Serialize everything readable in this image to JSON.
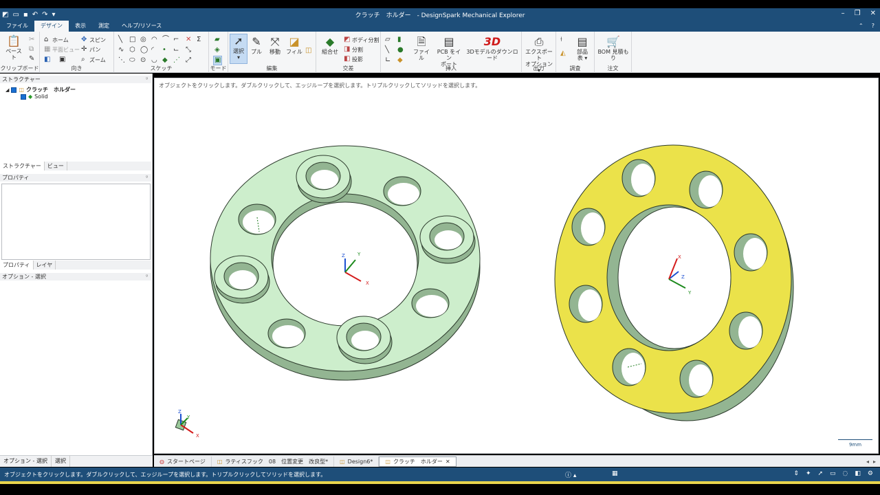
{
  "window": {
    "title": "クラッチ　ホルダー　- DesignSpark  Mechanical  Explorer"
  },
  "menu": {
    "tabs": [
      "ファイル",
      "デザイン",
      "表示",
      "測定",
      "ヘルプ/リソース"
    ],
    "active_index": 1
  },
  "ribbon": {
    "clipboard": {
      "paste": "ペースト",
      "label": "クリップボード"
    },
    "orient": {
      "home": "ホーム",
      "plan_view": "平面ビュー",
      "spin": "スピン",
      "pan": "パン",
      "zoom": "ズーム",
      "label": "向き"
    },
    "sketch": {
      "label": "スケッチ"
    },
    "mode": {
      "label": "モード"
    },
    "edit": {
      "select": "選択",
      "pull": "プル",
      "move": "移動",
      "fill": "フィル",
      "label": "編集"
    },
    "intersect": {
      "combine": "組合せ",
      "body_split": "ボディ分割",
      "split": "分割",
      "project": "投影",
      "label": "交差"
    },
    "insert": {
      "file": "ファイル",
      "pcb_line1": "PCB をイン",
      "pcb_line2": "ポート",
      "three_d_badge": "3D",
      "download": "3Dモデルのダウンロード",
      "label": "挿入"
    },
    "output": {
      "export_line1": "エクスポート",
      "export_line2": "オプション",
      "label": "出力"
    },
    "investigate": {
      "parts_line1": "部品",
      "parts_line2": "表",
      "label": "調査"
    },
    "order": {
      "bom_line1": "BOM 見積も",
      "bom_line2": "り",
      "label": "注文"
    }
  },
  "structure_panel": {
    "header": "ストラクチャー",
    "root": "クラッチ　ホルダー",
    "child": "Solid",
    "tabs": [
      "ストラクチャー",
      "ビュー"
    ]
  },
  "properties_panel": {
    "header": "プロパティ",
    "tabs": [
      "プロパティ",
      "レイヤ"
    ]
  },
  "options_panel": {
    "header": "オプション - 選択",
    "tabs": [
      "オプション - 選択",
      "選択"
    ]
  },
  "viewport": {
    "hint": "オブジェクトをクリックします。ダブルクリックして、エッジループを選択します。トリプルクリックしてソリッドを選択します。",
    "scale_label": "9mm",
    "axis_x": "X",
    "axis_y": "Y",
    "axis_z": "Z",
    "colors": {
      "green_part": "#cdeecc",
      "yellow_part": "#ebe24a",
      "edge": "#2c3a2c"
    }
  },
  "doc_tabs": [
    {
      "label": "スタートページ",
      "active": false
    },
    {
      "label": "ラティスフック　08　位置変更　改良型*",
      "active": false
    },
    {
      "label": "Design6*",
      "active": false
    },
    {
      "label": "クラッチ　ホルダー",
      "active": true
    }
  ],
  "status": {
    "message": "オブジェクトをクリックします。ダブルクリックして、エッジループを選択します。トリプルクリックしてソリッドを選択します。"
  }
}
